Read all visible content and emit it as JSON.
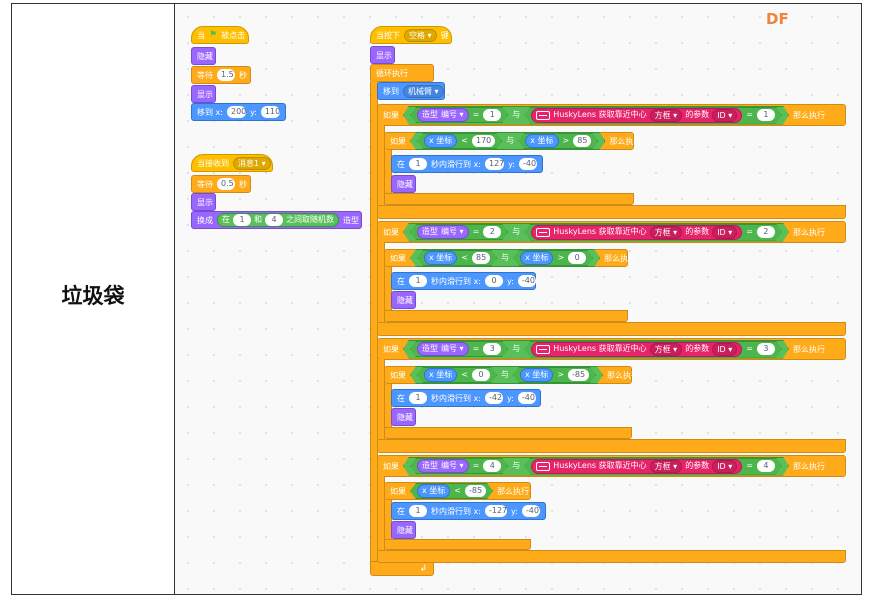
{
  "row_label": "垃圾袋",
  "logo": "DF",
  "script1": {
    "when": "当",
    "clicked": "被点击",
    "hide": "隐藏",
    "wait": "等待",
    "wait_val": "1.5",
    "sec": "秒",
    "show": "显示",
    "goto": "移到 x:",
    "goto_x": "200",
    "y": "y:",
    "goto_y": "110"
  },
  "script2": {
    "when_receive": "当接收到",
    "msg": "消息1 ▾",
    "wait": "等待",
    "wait_val": "0.5",
    "sec": "秒",
    "show": "显示",
    "switch": "换成",
    "in": "在",
    "a": "1",
    "and": "和",
    "b": "4",
    "between": "之间取随机数",
    "costume": "造型"
  },
  "script3": {
    "when_key": "当按下",
    "key": "空格 ▾",
    "key_suffix": "键",
    "show": "显示",
    "forever": "循环执行",
    "moveto": "移到",
    "target": "机械臂 ▾",
    "if": "如果",
    "then": "那么执行",
    "costume": "造型",
    "number": "编号 ▾",
    "eq": "=",
    "with": "与",
    "husky": "HuskyLens 获取靠近中心",
    "box": "方框 ▾",
    "param": "的参数",
    "id": "ID ▾",
    "xpos": "x 坐标",
    "lt": "<",
    "gt": ">",
    "glide_in": "在",
    "glide_sec": "1",
    "glide_text": "秒内滑行到 x:",
    "y": "y:",
    "hide": "隐藏",
    "loop_arrow": "↲",
    "branches": [
      {
        "n": "1",
        "cond_a": "170",
        "cond_b": "85",
        "gx": "127",
        "gy": "-40"
      },
      {
        "n": "2",
        "cond_a": "85",
        "cond_b": "0",
        "gx": "0",
        "gy": "-40"
      },
      {
        "n": "3",
        "cond_a": "0",
        "cond_b": "-85",
        "gx": "-42",
        "gy": "-40"
      },
      {
        "n": "4",
        "cond_a": "-85",
        "gx": "-127",
        "gy": "-40"
      }
    ]
  }
}
